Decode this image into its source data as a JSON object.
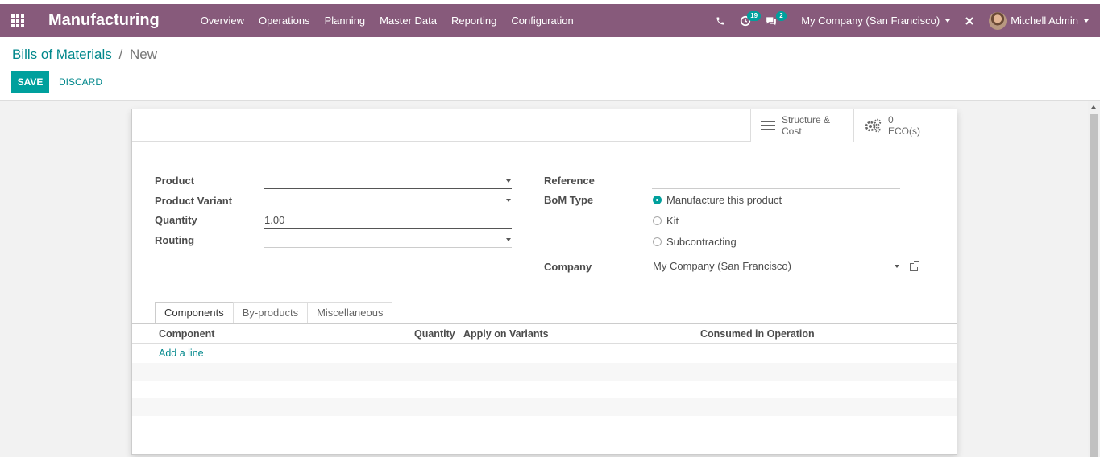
{
  "app": {
    "title": "Manufacturing"
  },
  "menu": [
    {
      "label": "Overview"
    },
    {
      "label": "Operations"
    },
    {
      "label": "Planning"
    },
    {
      "label": "Master Data"
    },
    {
      "label": "Reporting"
    },
    {
      "label": "Configuration"
    }
  ],
  "systray": {
    "activity_count": "19",
    "messages_count": "2",
    "company": "My Company (San Francisco)",
    "user": "Mitchell Admin"
  },
  "breadcrumb": {
    "parent": "Bills of Materials",
    "separator": "/",
    "current": "New"
  },
  "actions": {
    "save": "SAVE",
    "discard": "DISCARD"
  },
  "smart_buttons": {
    "structure": {
      "line1": "Structure &",
      "line2": "Cost"
    },
    "eco": {
      "count": "0",
      "label": "ECO(s)"
    }
  },
  "form": {
    "product": {
      "label": "Product",
      "value": ""
    },
    "product_variant": {
      "label": "Product Variant",
      "value": ""
    },
    "quantity": {
      "label": "Quantity",
      "value": "1.00"
    },
    "routing": {
      "label": "Routing",
      "value": ""
    },
    "reference": {
      "label": "Reference",
      "value": ""
    },
    "bom_type": {
      "label": "BoM Type",
      "options": [
        "Manufacture this product",
        "Kit",
        "Subcontracting"
      ],
      "selected": "Manufacture this product"
    },
    "company": {
      "label": "Company",
      "value": "My Company (San Francisco)"
    }
  },
  "tabs": [
    {
      "label": "Components",
      "active": true
    },
    {
      "label": "By-products",
      "active": false
    },
    {
      "label": "Miscellaneous",
      "active": false
    }
  ],
  "table": {
    "columns": [
      "Component",
      "Quantity",
      "Apply on Variants",
      "Consumed in Operation"
    ],
    "add_line": "Add a line"
  },
  "colors": {
    "navbar": "#875a7b",
    "primary": "#00a09d",
    "link": "#00878b"
  }
}
